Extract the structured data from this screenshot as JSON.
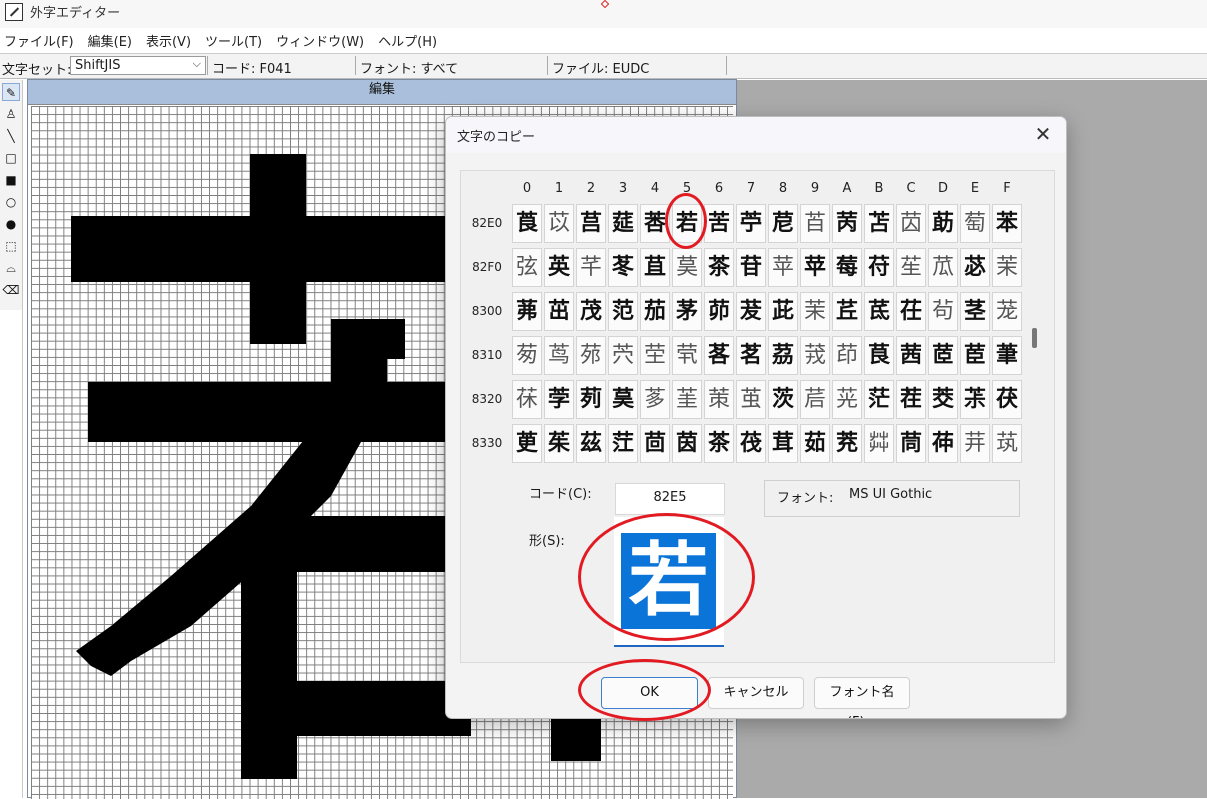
{
  "app": {
    "title": "外字エディター"
  },
  "menu": [
    "ファイル(F)",
    "編集(E)",
    "表示(V)",
    "ツール(T)",
    "ウィンドウ(W)",
    "ヘルプ(H)"
  ],
  "toolbar": {
    "charset_label": "文字セット:",
    "charset_value": "ShiftJIS",
    "code": "コード: F041",
    "font": "フォント: すべて",
    "file": "ファイル: EUDC"
  },
  "tools": [
    "pencil-icon",
    "brush-icon",
    "line-icon",
    "rectangle-icon",
    "filled-rectangle-icon",
    "ellipse-icon",
    "filled-ellipse-icon",
    "rect-select-icon",
    "freeform-select-icon",
    "eraser-icon"
  ],
  "edit_window": {
    "title": "編集"
  },
  "dialog": {
    "title": "文字のコピー",
    "columns": [
      "0",
      "1",
      "2",
      "3",
      "4",
      "5",
      "6",
      "7",
      "8",
      "9",
      "A",
      "B",
      "C",
      "D",
      "E",
      "F"
    ],
    "rows": [
      {
        "label": "82E0",
        "chars": [
          "莨",
          "苡",
          "莒",
          "莚",
          "莕",
          "若",
          "苦",
          "苧",
          "苨",
          "苩",
          "苪",
          "苫",
          "苬",
          "莇",
          "萄",
          "苯"
        ]
      },
      {
        "label": "82F0",
        "chars": [
          "弦",
          "英",
          "芊",
          "苳",
          "苴",
          "茣",
          "茶",
          "苷",
          "苹",
          "苹",
          "莓",
          "苻",
          "苼",
          "苽",
          "苾",
          "茉"
        ]
      },
      {
        "label": "8300",
        "chars": [
          "茀",
          "茁",
          "茂",
          "范",
          "茄",
          "茅",
          "茆",
          "茇",
          "茈",
          "茉",
          "茊",
          "茋",
          "茌",
          "茍",
          "茎",
          "茏"
        ]
      },
      {
        "label": "8310",
        "chars": [
          "茐",
          "茑",
          "茒",
          "茓",
          "茔",
          "茕",
          "茖",
          "茗",
          "茘",
          "茙",
          "茚",
          "茛",
          "茜",
          "茝",
          "茞",
          "茟"
        ]
      },
      {
        "label": "8320",
        "chars": [
          "茠",
          "茡",
          "茢",
          "茣",
          "茤",
          "茥",
          "茦",
          "茧",
          "茨",
          "茩",
          "茪",
          "茫",
          "茬",
          "茭",
          "茮",
          "茯"
        ]
      },
      {
        "label": "8330",
        "chars": [
          "茰",
          "茱",
          "茲",
          "茳",
          "茴",
          "茵",
          "茶",
          "茷",
          "茸",
          "茹",
          "茺",
          "茻",
          "茼",
          "茽",
          "茾",
          "茿"
        ]
      }
    ],
    "light_cells": [
      [
        0,
        1
      ],
      [
        1,
        0
      ],
      [
        1,
        2
      ],
      [
        1,
        5
      ],
      [
        1,
        8
      ],
      [
        1,
        12
      ],
      [
        1,
        15
      ],
      [
        2,
        9
      ],
      [
        2,
        13
      ],
      [
        2,
        15
      ],
      [
        3,
        0
      ],
      [
        3,
        1
      ],
      [
        3,
        2
      ],
      [
        3,
        3
      ],
      [
        3,
        4
      ],
      [
        3,
        5
      ],
      [
        3,
        9
      ],
      [
        3,
        10
      ],
      [
        4,
        0
      ],
      [
        4,
        4
      ],
      [
        4,
        5
      ],
      [
        4,
        6
      ],
      [
        4,
        7
      ],
      [
        4,
        9
      ],
      [
        4,
        10
      ],
      [
        5,
        11
      ],
      [
        5,
        14
      ],
      [
        5,
        15
      ],
      [
        0,
        9
      ],
      [
        0,
        12
      ],
      [
        0,
        14
      ],
      [
        1,
        13
      ]
    ],
    "code_label": "コード(C):",
    "code_value": "82E5",
    "font_label": "フォント:",
    "font_value": "MS UI Gothic",
    "shape_label": "形(S):",
    "shape_char": "若",
    "buttons": {
      "ok": "OK",
      "cancel": "キャンセル",
      "font_name": "フォント名(F)..."
    }
  },
  "annotation_color": "#e21b23",
  "accent_color": "#0a74d8"
}
